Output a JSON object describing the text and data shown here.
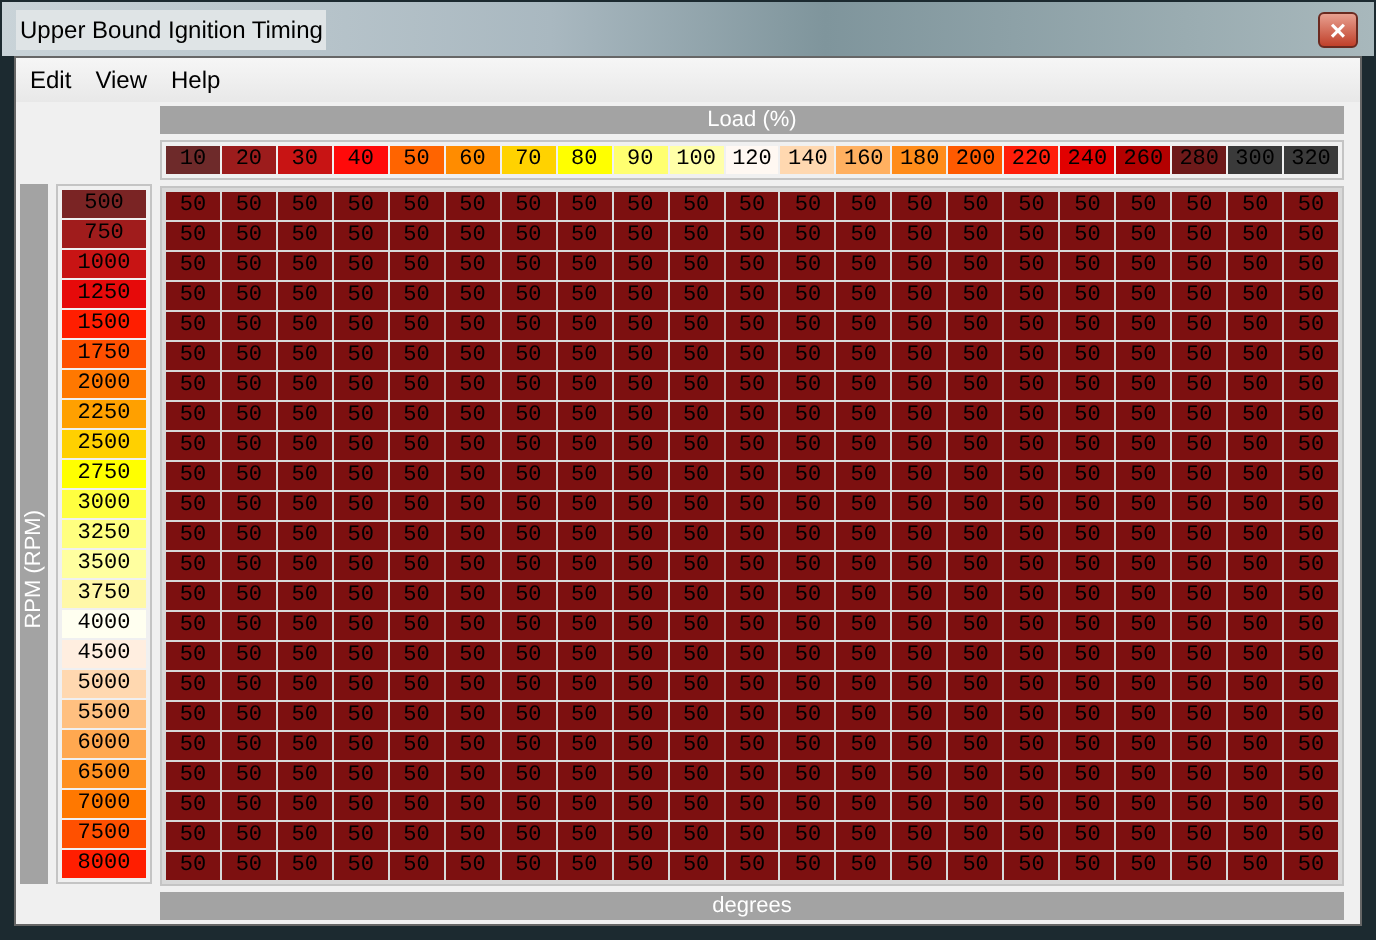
{
  "window": {
    "title": "Upper Bound Ignition Timing",
    "close": "×"
  },
  "menu": [
    "Edit",
    "View",
    "Help"
  ],
  "x_axis": {
    "label": "Load (%)",
    "columns": [
      {
        "label": "10",
        "color": "#6e2a2a"
      },
      {
        "label": "20",
        "color": "#9c1c1c"
      },
      {
        "label": "30",
        "color": "#c81414"
      },
      {
        "label": "40",
        "color": "#ff0a0a"
      },
      {
        "label": "50",
        "color": "#ff6400"
      },
      {
        "label": "60",
        "color": "#ff8c00"
      },
      {
        "label": "70",
        "color": "#ffd200"
      },
      {
        "label": "80",
        "color": "#ffff00"
      },
      {
        "label": "90",
        "color": "#ffff70"
      },
      {
        "label": "100",
        "color": "#ffffa8"
      },
      {
        "label": "120",
        "color": "#fff8f2"
      },
      {
        "label": "140",
        "color": "#ffd8b0"
      },
      {
        "label": "160",
        "color": "#ffb060"
      },
      {
        "label": "180",
        "color": "#ff8c1a"
      },
      {
        "label": "200",
        "color": "#ff5a00"
      },
      {
        "label": "220",
        "color": "#ff1e0a"
      },
      {
        "label": "240",
        "color": "#e10000"
      },
      {
        "label": "260",
        "color": "#b40000"
      },
      {
        "label": "280",
        "color": "#6e1a1a"
      },
      {
        "label": "300",
        "color": "#3a3a3a"
      },
      {
        "label": "320",
        "color": "#3a3a3a"
      }
    ]
  },
  "y_axis": {
    "label": "RPM (RPM)",
    "rows": [
      {
        "label": "500",
        "color": "#7a2424"
      },
      {
        "label": "750",
        "color": "#a01c1c"
      },
      {
        "label": "1000",
        "color": "#c81414"
      },
      {
        "label": "1250",
        "color": "#e60a0a"
      },
      {
        "label": "1500",
        "color": "#ff1e00"
      },
      {
        "label": "1750",
        "color": "#ff5000"
      },
      {
        "label": "2000",
        "color": "#ff7800"
      },
      {
        "label": "2250",
        "color": "#ffa000"
      },
      {
        "label": "2500",
        "color": "#ffd000"
      },
      {
        "label": "2750",
        "color": "#ffff00"
      },
      {
        "label": "3000",
        "color": "#ffff40"
      },
      {
        "label": "3250",
        "color": "#ffff80"
      },
      {
        "label": "3500",
        "color": "#ffffa0"
      },
      {
        "label": "3750",
        "color": "#fff8a8"
      },
      {
        "label": "4000",
        "color": "#fffff0"
      },
      {
        "label": "4500",
        "color": "#ffeee0"
      },
      {
        "label": "5000",
        "color": "#ffd8b0"
      },
      {
        "label": "5500",
        "color": "#ffc080"
      },
      {
        "label": "6000",
        "color": "#ffa850"
      },
      {
        "label": "6500",
        "color": "#ff9020"
      },
      {
        "label": "7000",
        "color": "#ff7800"
      },
      {
        "label": "7500",
        "color": "#ff5000"
      },
      {
        "label": "8000",
        "color": "#ff1e00"
      }
    ]
  },
  "table": {
    "value_label": "degrees",
    "rows": [
      [
        "50",
        "50",
        "50",
        "50",
        "50",
        "50",
        "50",
        "50",
        "50",
        "50",
        "50",
        "50",
        "50",
        "50",
        "50",
        "50",
        "50",
        "50",
        "50",
        "50",
        "50"
      ],
      [
        "50",
        "50",
        "50",
        "50",
        "50",
        "50",
        "50",
        "50",
        "50",
        "50",
        "50",
        "50",
        "50",
        "50",
        "50",
        "50",
        "50",
        "50",
        "50",
        "50",
        "50"
      ],
      [
        "50",
        "50",
        "50",
        "50",
        "50",
        "50",
        "50",
        "50",
        "50",
        "50",
        "50",
        "50",
        "50",
        "50",
        "50",
        "50",
        "50",
        "50",
        "50",
        "50",
        "50"
      ],
      [
        "50",
        "50",
        "50",
        "50",
        "50",
        "50",
        "50",
        "50",
        "50",
        "50",
        "50",
        "50",
        "50",
        "50",
        "50",
        "50",
        "50",
        "50",
        "50",
        "50",
        "50"
      ],
      [
        "50",
        "50",
        "50",
        "50",
        "50",
        "50",
        "50",
        "50",
        "50",
        "50",
        "50",
        "50",
        "50",
        "50",
        "50",
        "50",
        "50",
        "50",
        "50",
        "50",
        "50"
      ],
      [
        "50",
        "50",
        "50",
        "50",
        "50",
        "50",
        "50",
        "50",
        "50",
        "50",
        "50",
        "50",
        "50",
        "50",
        "50",
        "50",
        "50",
        "50",
        "50",
        "50",
        "50"
      ],
      [
        "50",
        "50",
        "50",
        "50",
        "50",
        "50",
        "50",
        "50",
        "50",
        "50",
        "50",
        "50",
        "50",
        "50",
        "50",
        "50",
        "50",
        "50",
        "50",
        "50",
        "50"
      ],
      [
        "50",
        "50",
        "50",
        "50",
        "50",
        "50",
        "50",
        "50",
        "50",
        "50",
        "50",
        "50",
        "50",
        "50",
        "50",
        "50",
        "50",
        "50",
        "50",
        "50",
        "50"
      ],
      [
        "50",
        "50",
        "50",
        "50",
        "50",
        "50",
        "50",
        "50",
        "50",
        "50",
        "50",
        "50",
        "50",
        "50",
        "50",
        "50",
        "50",
        "50",
        "50",
        "50",
        "50"
      ],
      [
        "50",
        "50",
        "50",
        "50",
        "50",
        "50",
        "50",
        "50",
        "50",
        "50",
        "50",
        "50",
        "50",
        "50",
        "50",
        "50",
        "50",
        "50",
        "50",
        "50",
        "50"
      ],
      [
        "50",
        "50",
        "50",
        "50",
        "50",
        "50",
        "50",
        "50",
        "50",
        "50",
        "50",
        "50",
        "50",
        "50",
        "50",
        "50",
        "50",
        "50",
        "50",
        "50",
        "50"
      ],
      [
        "50",
        "50",
        "50",
        "50",
        "50",
        "50",
        "50",
        "50",
        "50",
        "50",
        "50",
        "50",
        "50",
        "50",
        "50",
        "50",
        "50",
        "50",
        "50",
        "50",
        "50"
      ],
      [
        "50",
        "50",
        "50",
        "50",
        "50",
        "50",
        "50",
        "50",
        "50",
        "50",
        "50",
        "50",
        "50",
        "50",
        "50",
        "50",
        "50",
        "50",
        "50",
        "50",
        "50"
      ],
      [
        "50",
        "50",
        "50",
        "50",
        "50",
        "50",
        "50",
        "50",
        "50",
        "50",
        "50",
        "50",
        "50",
        "50",
        "50",
        "50",
        "50",
        "50",
        "50",
        "50",
        "50"
      ],
      [
        "50",
        "50",
        "50",
        "50",
        "50",
        "50",
        "50",
        "50",
        "50",
        "50",
        "50",
        "50",
        "50",
        "50",
        "50",
        "50",
        "50",
        "50",
        "50",
        "50",
        "50"
      ],
      [
        "50",
        "50",
        "50",
        "50",
        "50",
        "50",
        "50",
        "50",
        "50",
        "50",
        "50",
        "50",
        "50",
        "50",
        "50",
        "50",
        "50",
        "50",
        "50",
        "50",
        "50"
      ],
      [
        "50",
        "50",
        "50",
        "50",
        "50",
        "50",
        "50",
        "50",
        "50",
        "50",
        "50",
        "50",
        "50",
        "50",
        "50",
        "50",
        "50",
        "50",
        "50",
        "50",
        "50"
      ],
      [
        "50",
        "50",
        "50",
        "50",
        "50",
        "50",
        "50",
        "50",
        "50",
        "50",
        "50",
        "50",
        "50",
        "50",
        "50",
        "50",
        "50",
        "50",
        "50",
        "50",
        "50"
      ],
      [
        "50",
        "50",
        "50",
        "50",
        "50",
        "50",
        "50",
        "50",
        "50",
        "50",
        "50",
        "50",
        "50",
        "50",
        "50",
        "50",
        "50",
        "50",
        "50",
        "50",
        "50"
      ],
      [
        "50",
        "50",
        "50",
        "50",
        "50",
        "50",
        "50",
        "50",
        "50",
        "50",
        "50",
        "50",
        "50",
        "50",
        "50",
        "50",
        "50",
        "50",
        "50",
        "50",
        "50"
      ],
      [
        "50",
        "50",
        "50",
        "50",
        "50",
        "50",
        "50",
        "50",
        "50",
        "50",
        "50",
        "50",
        "50",
        "50",
        "50",
        "50",
        "50",
        "50",
        "50",
        "50",
        "50"
      ],
      [
        "50",
        "50",
        "50",
        "50",
        "50",
        "50",
        "50",
        "50",
        "50",
        "50",
        "50",
        "50",
        "50",
        "50",
        "50",
        "50",
        "50",
        "50",
        "50",
        "50",
        "50"
      ],
      [
        "50",
        "50",
        "50",
        "50",
        "50",
        "50",
        "50",
        "50",
        "50",
        "50",
        "50",
        "50",
        "50",
        "50",
        "50",
        "50",
        "50",
        "50",
        "50",
        "50",
        "50"
      ]
    ]
  }
}
